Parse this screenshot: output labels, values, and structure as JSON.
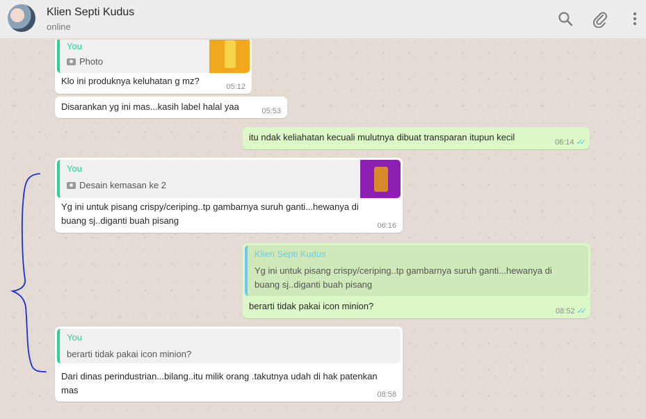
{
  "header": {
    "contact_name": "Klien Septi Kudus",
    "status": "online",
    "icons": [
      "search-icon",
      "paperclip-icon",
      "menu-icon"
    ]
  },
  "messages": [
    {
      "id": "m1",
      "direction": "incoming",
      "quote_author": "You",
      "quote_text": "Photo",
      "quote_thumb_color": "#f2a81d",
      "text": "Klo ini produknya keluhatan g mz?",
      "time": "05:12"
    },
    {
      "id": "m2",
      "direction": "incoming",
      "text": "Disarankan yg ini mas...kasih label halal yaa",
      "time": "05:53"
    },
    {
      "id": "m3",
      "direction": "outgoing",
      "text": "itu ndak keliahatan kecuali mulutnya dibuat transparan itupun kecil",
      "time": "06:14"
    },
    {
      "id": "m4",
      "direction": "incoming",
      "quote_author": "You",
      "quote_text": "Desain kemasan ke 2",
      "quote_thumb_color": "#8e1fb3",
      "text_line1": "Yg ini untuk pisang crispy/ceriping..tp gambarnya suruh ganti...hewanya di",
      "text_line2": "buang sj..diganti buah pisang",
      "time": "06:16"
    },
    {
      "id": "m5",
      "direction": "outgoing",
      "quote_author": "Klien Septi Kudus",
      "quote_line1": "Yg ini untuk pisang crispy/ceriping..tp gambarnya suruh ganti...hewanya di",
      "quote_line2": "buang sj..diganti buah pisang",
      "text": "berarti tidak pakai icon minion?",
      "time": "08:52"
    },
    {
      "id": "m6",
      "direction": "incoming",
      "quote_author": "You",
      "quote_text": "berarti tidak pakai icon minion?",
      "text_line1": "Dari dinas perindustrian...bilang..itu milik orang .takutnya udah di hak patenkan",
      "text_line2": "mas",
      "time": "08:58"
    }
  ],
  "colors": {
    "incoming_bg": "#ffffff",
    "outgoing_bg": "#dcf8c6",
    "read_ticks": "#4fc3f7",
    "quote_you": "#35cd96",
    "quote_contact": "#6bcbef",
    "annotation_ink": "#1c2fd6"
  }
}
